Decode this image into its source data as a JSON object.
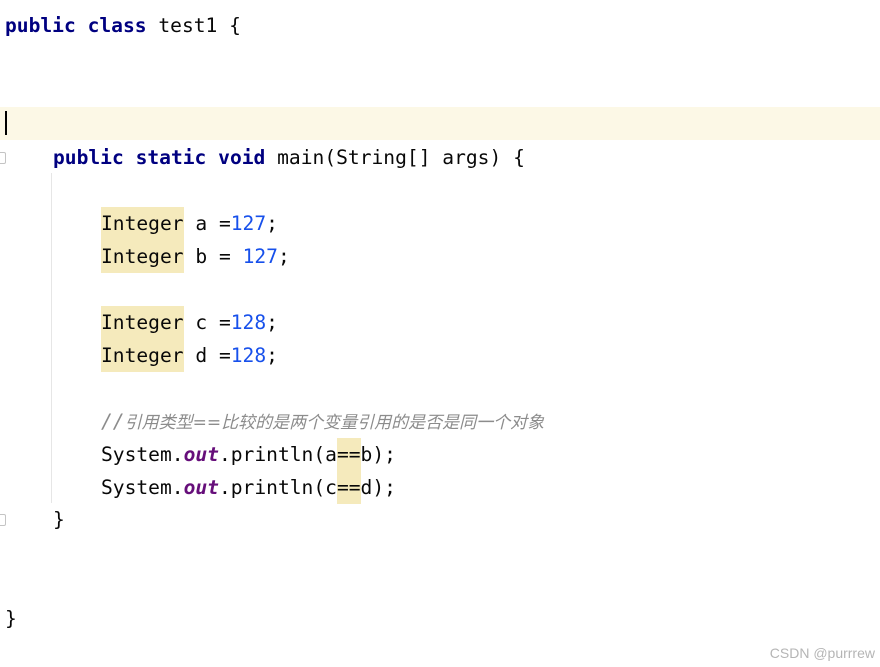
{
  "code": {
    "class_keyword_public": "public",
    "class_keyword_class": "class",
    "class_name_and_brace": " test1 {",
    "method_public": "public",
    "method_static": "static",
    "method_void": "void",
    "method_signature": " main(String[] args) {",
    "type_integer": "Integer",
    "decl_a_text": " a =",
    "decl_a_value": "127",
    "decl_b_text": " b = ",
    "decl_b_value": "127",
    "decl_c_text": " c =",
    "decl_c_value": "128",
    "decl_d_text": " d =",
    "decl_d_value": "128",
    "semicolon": ";",
    "comment_slashes": "//",
    "comment_text": "引用类型==比较的是两个变量引用的是否是同一个对象",
    "system_text": "System.",
    "out_field": "out",
    "println_open_a": ".println(a",
    "equals_op": "==",
    "println_close_b": "b);",
    "println_open_c": ".println(c",
    "println_close_d": "d);",
    "method_close": "}",
    "class_close": "}"
  },
  "watermark": "CSDN @purrrew",
  "colors": {
    "keyword": "#000080",
    "number": "#1750eb",
    "static_field": "#660e7a",
    "comment": "#8c8c8c",
    "current_line_bg": "#fcf8e6",
    "usage_highlight": "#f5eabc"
  }
}
